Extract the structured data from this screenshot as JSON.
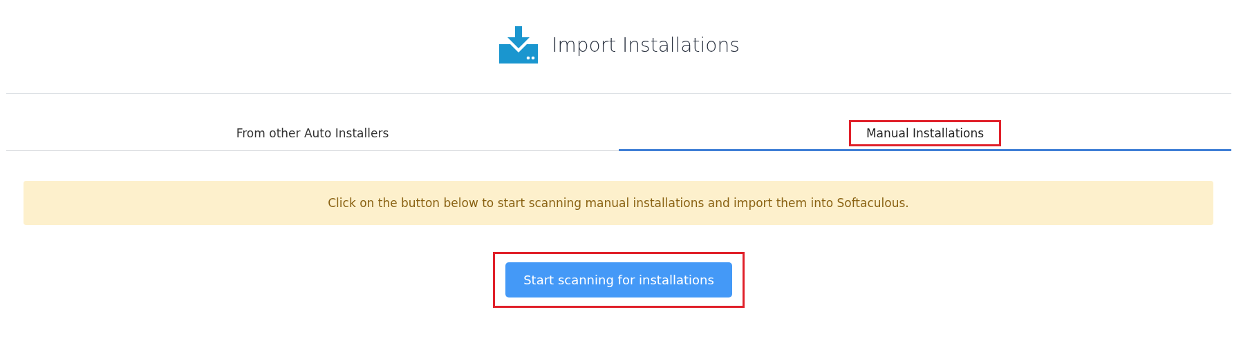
{
  "header": {
    "title": "Import Installations"
  },
  "tabs": [
    {
      "label": "From other Auto Installers",
      "selected": false,
      "highlighted": false
    },
    {
      "label": "Manual Installations",
      "selected": true,
      "highlighted": true
    }
  ],
  "notice": {
    "text": "Click on the button below to start scanning manual installations and import them into Softaculous."
  },
  "scan_button": {
    "label": "Start scanning for installations",
    "highlighted": true
  }
}
